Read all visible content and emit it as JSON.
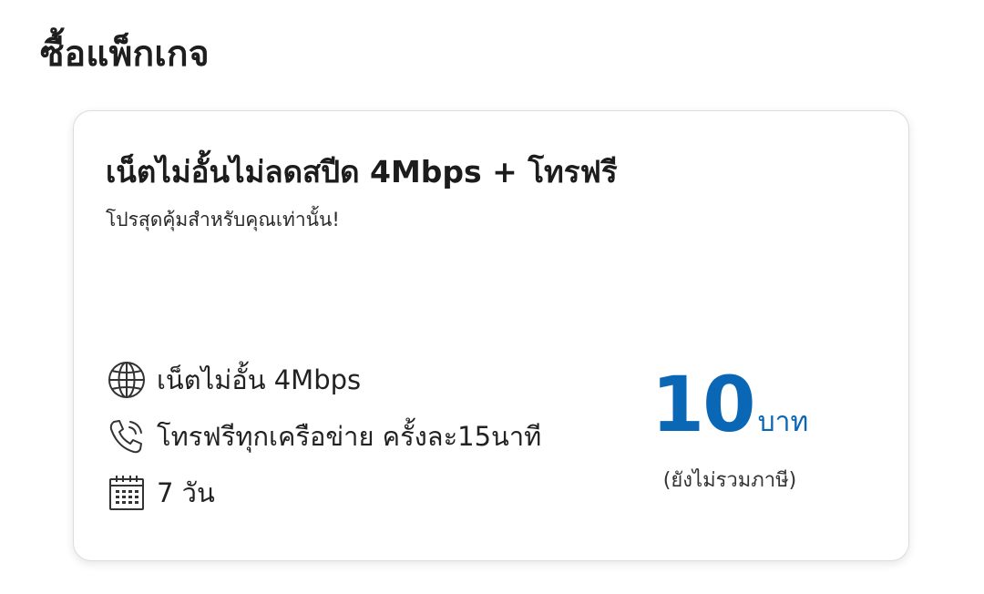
{
  "header": {
    "title": "ซื้อแพ็กเกจ"
  },
  "package_card": {
    "title": "เน็ตไม่อั้นไม่ลดสปีด 4Mbps + โทรฟรี",
    "subtitle": "โปรสุดคุ้มสำหรับคุณเท่านั้น!",
    "features": [
      {
        "icon": "globe-icon",
        "label": "เน็ตไม่อั้น 4Mbps"
      },
      {
        "icon": "phone-call-icon",
        "label": "โทรฟรีทุกเครือข่าย ครั้งละ15นาที"
      },
      {
        "icon": "calendar-icon",
        "label": "7 วัน"
      }
    ],
    "price": {
      "amount": "10",
      "unit": "บาท",
      "note": "(ยังไม่รวมภาษี)"
    }
  },
  "colors": {
    "accent": "#0a67b5",
    "text": "#1c1c1c",
    "card_border": "#dcdcdc"
  }
}
